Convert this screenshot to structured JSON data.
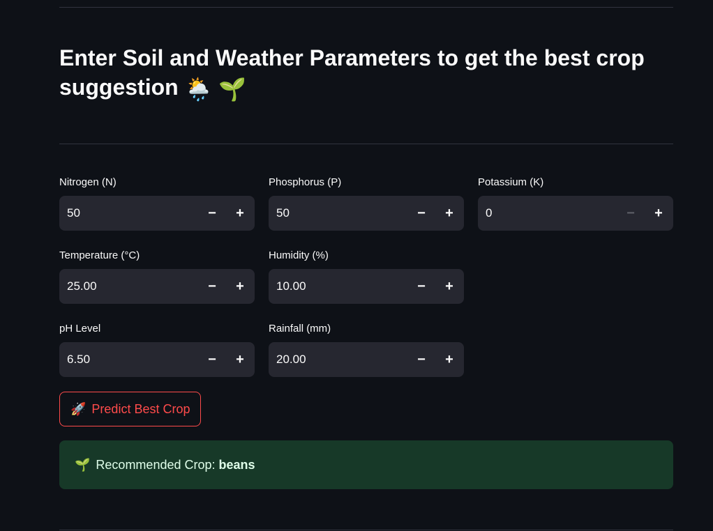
{
  "header": {
    "title": "Enter Soil and Weather Parameters to get the best crop suggestion",
    "title_emojis": [
      "🌦️",
      "🌱"
    ]
  },
  "fields": [
    {
      "label": "Nitrogen (N)",
      "value": "50",
      "decrement_enabled": true
    },
    {
      "label": "Phosphorus (P)",
      "value": "50",
      "decrement_enabled": true
    },
    {
      "label": "Potassium (K)",
      "value": "0",
      "decrement_enabled": false
    },
    {
      "label": "Temperature (°C)",
      "value": "25.00",
      "decrement_enabled": true
    },
    {
      "label": "Humidity (%)",
      "value": "10.00",
      "decrement_enabled": true
    },
    {
      "label": "pH Level",
      "value": "6.50",
      "decrement_enabled": true
    },
    {
      "label": "Rainfall (mm)",
      "value": "20.00",
      "decrement_enabled": true
    }
  ],
  "stepper": {
    "minus": "−",
    "plus": "+"
  },
  "predict_button": {
    "icon": "🚀",
    "label": "Predict Best Crop"
  },
  "result": {
    "icon": "🌱",
    "prefix": "Recommended Crop:",
    "crop": "beans"
  },
  "colors": {
    "background": "#0e1117",
    "input_bg": "#262730",
    "accent": "#ff4b4b",
    "success_bg": "#173928",
    "success_text": "#dffde9"
  }
}
